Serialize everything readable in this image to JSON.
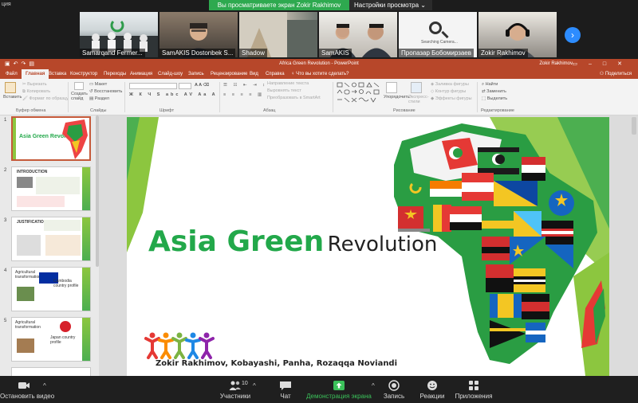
{
  "zoom": {
    "top_left_text": "ция",
    "share_banner": "Вы просматриваете экран Zokir Rakhimov",
    "view_options": "Настройки просмотра",
    "participants_tiles": [
      {
        "name": "Samarqand Fermer..."
      },
      {
        "name": "SamAKIS Dostonbek S..."
      },
      {
        "name": "Shadow"
      },
      {
        "name": "SamAKIS"
      },
      {
        "name": "Пропазар Бобомирзаев",
        "caption": "Searching Camera..."
      },
      {
        "name": "Zokir Rakhimov"
      }
    ],
    "toolbar": {
      "stop_video": "Остановить видео",
      "participants": "Участники",
      "participants_count": "10",
      "chat": "Чат",
      "share_screen": "Демонстрация экрана",
      "record": "Запись",
      "reactions": "Реакции",
      "apps": "Приложения"
    }
  },
  "ppt": {
    "window_title": "Africa Green Revolution - PowerPoint",
    "user": "Zokir Rakhimov",
    "share": "Поделиться",
    "tabs": [
      "Файл",
      "Главная",
      "Вставка",
      "Конструктор",
      "Переходы",
      "Анимация",
      "Слайд-шоу",
      "Запись",
      "Рецензирование",
      "Вид",
      "Справка",
      "Что вы хотите сделать?"
    ],
    "ribbon": {
      "paste": "Вставить",
      "cut": "Вырезать",
      "copy": "Копировать",
      "format_painter": "Формат по образцу",
      "clipboard_group": "Буфер обмена",
      "new_slide": "Создать слайд",
      "layout": "Макет",
      "reset": "Восстановить",
      "section": "Раздел",
      "slides_group": "Слайды",
      "font_group": "Шрифт",
      "text_direction": "Направление текста",
      "align_text": "Выровнять текст",
      "convert_smartart": "Преобразовать в SmartArt",
      "paragraph_group": "Абзац",
      "arrange": "Упорядочить",
      "quick_styles": "Экспресс-стили",
      "shape_fill": "Заливка фигуры",
      "shape_outline": "Контур фигуры",
      "shape_effects": "Эффекты фигуры",
      "drawing_group": "Рисование",
      "find": "Найти",
      "replace": "Заменить",
      "select": "Выделить",
      "editing_group": "Редактирование"
    },
    "thumbnails": [
      {
        "num": "1",
        "title": "Asia Green Revolution"
      },
      {
        "num": "2",
        "title": "INTRODUCTION"
      },
      {
        "num": "3",
        "title": "JUSTIFICATION"
      },
      {
        "num": "4",
        "title": "Agricultural transformation",
        "sub": "Cambodia country profile"
      },
      {
        "num": "5",
        "title": "Agricultural transformation",
        "sub": "Japan country profile"
      }
    ],
    "slide": {
      "title_green": "Asia Green",
      "title_rest": "Revolution",
      "authors": "Zokir Rakhimov, Kobayashi, Panha, Rozaqqa Noviandi"
    }
  }
}
